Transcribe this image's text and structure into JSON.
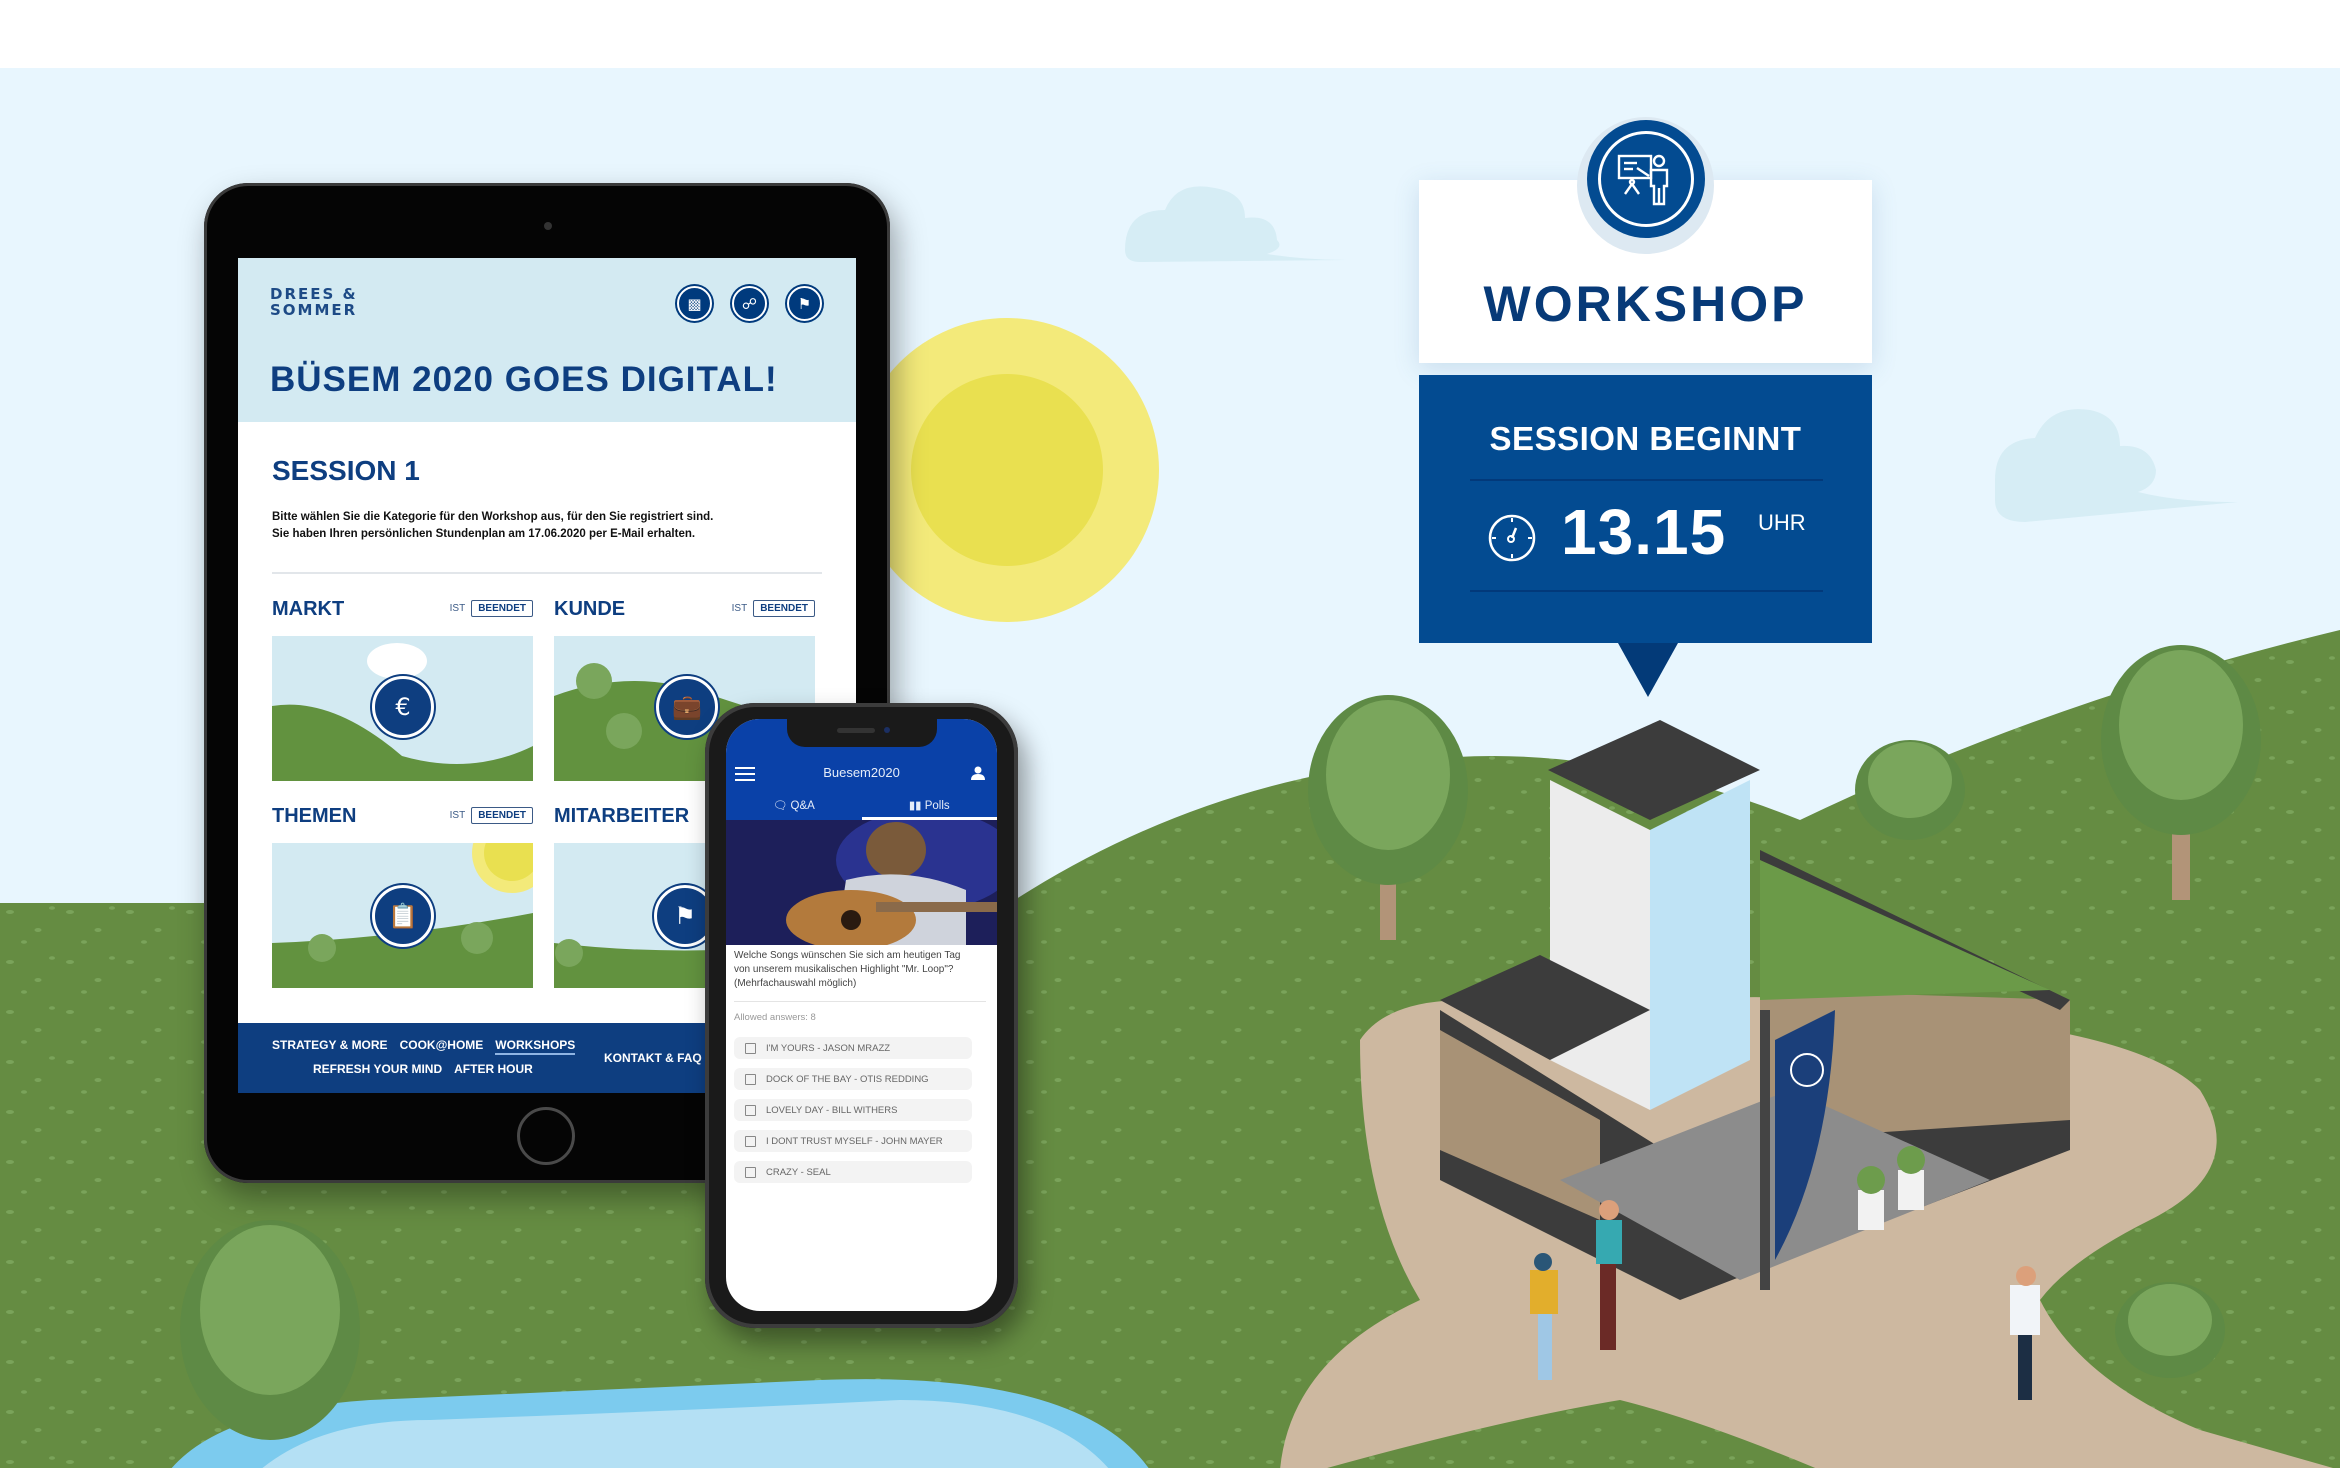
{
  "tablet": {
    "logo_line1": "DREES &",
    "logo_line2": "SOMMER",
    "header_icons": [
      "chat-icon",
      "share-icon",
      "flag-icon"
    ],
    "title": "BÜSEM 2020 GOES DIGITAL!",
    "session_title": "SESSION 1",
    "description_line1": "Bitte wählen Sie die Kategorie für den Workshop aus, für den Sie registriert sind.",
    "description_line2": "Sie haben Ihren persönlichen Stundenplan am 17.06.2020 per E-Mail erhalten.",
    "categories": [
      {
        "label": "MARKT",
        "status_prefix": "IST",
        "status": "BEENDET",
        "icon": "euro-city-icon"
      },
      {
        "label": "KUNDE",
        "status_prefix": "IST",
        "status": "BEENDET",
        "icon": "customer-briefcase-icon"
      },
      {
        "label": "THEMEN",
        "status_prefix": "IST",
        "status": "BEENDET",
        "icon": "checklist-pen-icon"
      },
      {
        "label": "MITARBEITER",
        "status_prefix": "",
        "status": "",
        "icon": "person-summit-flag-icon"
      }
    ],
    "footer_nav": {
      "row1": [
        "STRATEGY & MORE",
        "COOK@HOME",
        "WORKSHOPS"
      ],
      "row2": [
        "REFRESH YOUR MIND",
        "AFTER HOUR"
      ],
      "active": "WORKSHOPS",
      "contact": "KONTAKT & FAQ"
    }
  },
  "phone": {
    "app_title": "Buesem2020",
    "tabs": [
      {
        "label": "Q&A",
        "icon": "chat-bubbles-icon",
        "active": false
      },
      {
        "label": "Polls",
        "icon": "bar-chart-icon",
        "active": true
      }
    ],
    "question_line1": "Welche Songs wünschen Sie sich am heutigen Tag",
    "question_line2": "von unserem musikalischen Highlight \"Mr. Loop\"?",
    "question_line3": "(Mehrfachauswahl möglich)",
    "allowed_answers": "Allowed answers: 8",
    "options": [
      {
        "label": "I'M YOURS - JASON MRAZZ",
        "checked": false
      },
      {
        "label": "DOCK OF THE BAY - OTIS REDDING",
        "checked": false
      },
      {
        "label": "LOVELY DAY - BILL WITHERS",
        "checked": false
      },
      {
        "label": "I DONT TRUST MYSELF - JOHN MAYER",
        "checked": false
      },
      {
        "label": "CRAZY - SEAL",
        "checked": false
      }
    ]
  },
  "sign": {
    "icon": "presenter-whiteboard-icon",
    "title": "WORKSHOP",
    "subtitle": "SESSION BEGINNT",
    "time": "13.15",
    "time_unit": "UHR"
  },
  "colors": {
    "brand_blue": "#0e3e80",
    "sign_blue": "#034b91",
    "app_blue": "#0a41a8",
    "sky": "#e8f6fe",
    "grass": "#658c42",
    "sun_outer": "#f3ea7a",
    "sun_inner": "#e9e050"
  }
}
